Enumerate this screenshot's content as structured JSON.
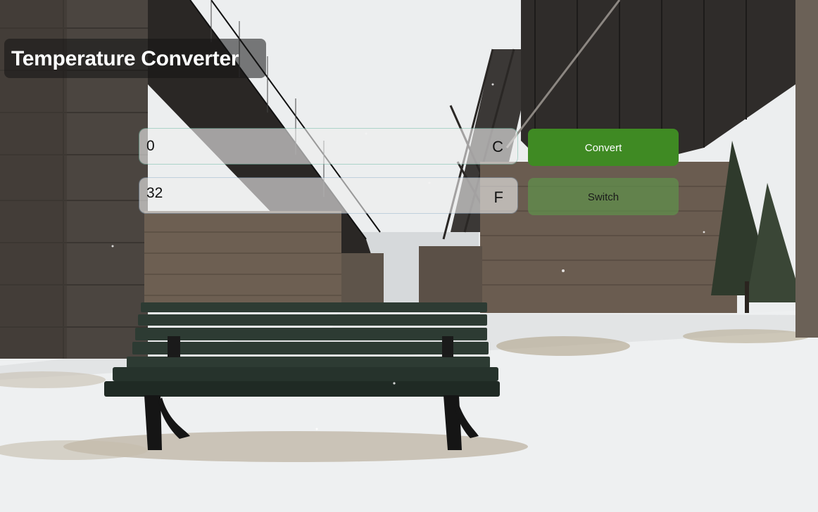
{
  "app": {
    "title": "Temperature Converter"
  },
  "converter": {
    "celsius_value": "0",
    "celsius_unit": "C",
    "fahrenheit_value": "32",
    "fahrenheit_unit": "F",
    "convert_label": "Convert",
    "switch_label": "Switch"
  },
  "background": {
    "scene": "snowy park bench under railway bridge"
  },
  "colors": {
    "convert_button": "#3f8a23",
    "switch_button": "#5f914b"
  }
}
